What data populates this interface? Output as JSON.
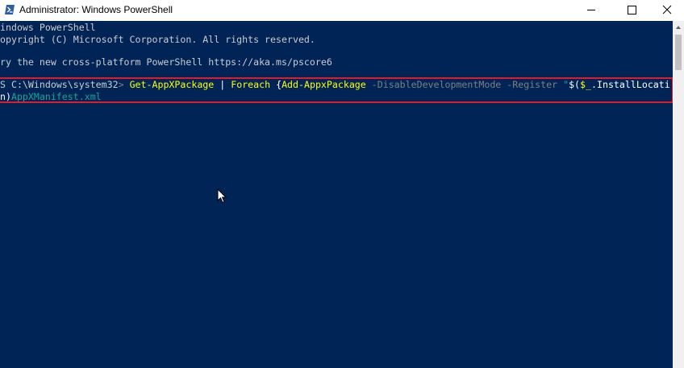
{
  "window": {
    "title": "Administrator: Windows PowerShell",
    "icons": {
      "app": "powershell-icon",
      "minimize": "minimize-icon",
      "maximize": "maximize-icon",
      "close": "close-icon"
    }
  },
  "console": {
    "line1": "indows PowerShell",
    "line2": "opyright (C) Microsoft Corporation. All rights reserved.",
    "line3": "ry the new cross-platform PowerShell https://aka.ms/pscore6",
    "prompt": "S C:\\Windows\\system32",
    "prompt_symbol": ">",
    "cmd1": "Get-AppXPackage",
    "pipe": "|",
    "cmd2": "Foreach",
    "brace": "{",
    "cmd3": "Add-AppxPackage",
    "param1": "-DisableDevelopmentMode",
    "param2": "-Register",
    "str_open": "\"",
    "sub_open": "$(",
    "var": "$_",
    "prop": ".InstallLocati",
    "cont_prop": "n)",
    "cont_str": "AppXManifest.xml"
  },
  "colors": {
    "background": "#012456",
    "highlight_border": "#e11b2a",
    "command": "#ffff00",
    "parameter": "#7f7f7f",
    "string": "#16a596"
  }
}
